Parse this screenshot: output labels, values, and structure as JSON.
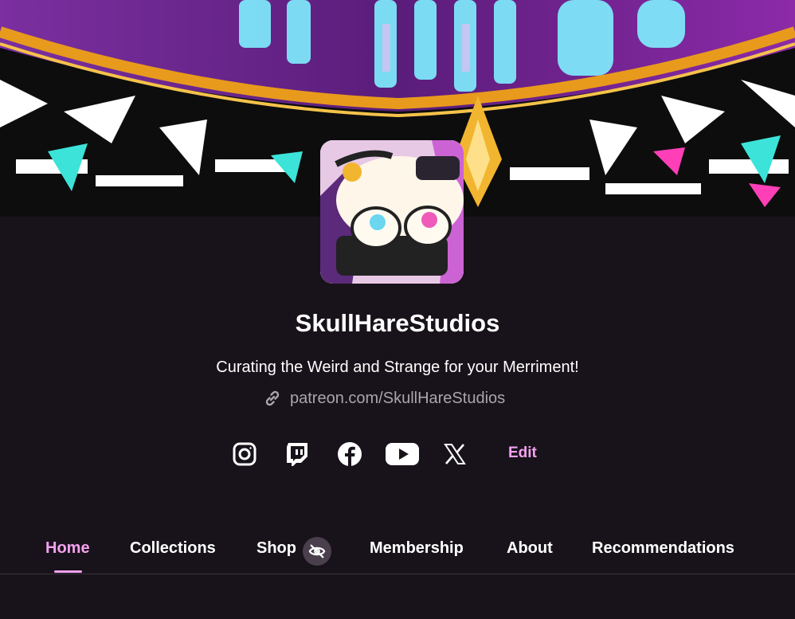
{
  "profile": {
    "name": "SkullHareStudios",
    "tagline": "Curating the Weird and Strange for your Merriment!",
    "url": "patreon.com/SkullHareStudios"
  },
  "socials": [
    {
      "icon": "instagram-icon"
    },
    {
      "icon": "twitch-icon"
    },
    {
      "icon": "facebook-icon"
    },
    {
      "icon": "youtube-icon"
    },
    {
      "icon": "x-icon"
    }
  ],
  "edit_label": "Edit",
  "tabs": [
    {
      "label": "Home",
      "active": true
    },
    {
      "label": "Collections"
    },
    {
      "label": "Shop",
      "badge_icon": "eye-off-icon"
    },
    {
      "label": "Membership"
    },
    {
      "label": "About"
    },
    {
      "label": "Recommendations"
    }
  ],
  "colors": {
    "background": "#18131a",
    "accent": "#f5a1f0",
    "muted_text": "#a9a5ab"
  }
}
